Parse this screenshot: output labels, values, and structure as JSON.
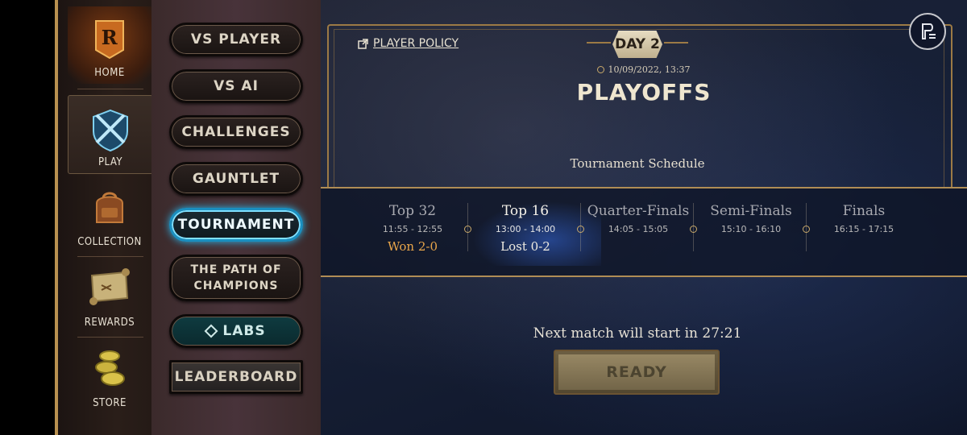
{
  "nav": {
    "items": [
      {
        "label": "HOME",
        "icon": "home-r-icon"
      },
      {
        "label": "PLAY",
        "icon": "crossed-swords-shield-icon"
      },
      {
        "label": "COLLECTION",
        "icon": "backpack-icon"
      },
      {
        "label": "REWARDS",
        "icon": "scroll-map-icon"
      },
      {
        "label": "STORE",
        "icon": "coins-icon"
      }
    ],
    "active": "PLAY"
  },
  "modes": {
    "vs_player": "VS PLAYER",
    "vs_ai": "VS AI",
    "challenges": "CHALLENGES",
    "gauntlet": "GAUNTLET",
    "tournament": "TOURNAMENT",
    "path_line1": "THE PATH OF",
    "path_line2": "CHAMPIONS",
    "labs": "LABS",
    "leaderboard": "LEADERBOARD",
    "active": "TOURNAMENT"
  },
  "main": {
    "player_policy": "PLAYER POLICY",
    "day": "DAY 2",
    "datetime": "10/09/2022, 13:37",
    "title": "PLAYOFFS",
    "schedule_title": "Tournament Schedule",
    "stages": [
      {
        "name": "Top 32",
        "time": "11:55 - 12:55",
        "result": "Won 2-0"
      },
      {
        "name": "Top 16",
        "time": "13:00 - 14:00",
        "result": "Lost 0-2"
      },
      {
        "name": "Quarter-Finals",
        "time": "14:05 - 15:05",
        "result": ""
      },
      {
        "name": "Semi-Finals",
        "time": "15:10 - 16:10",
        "result": ""
      },
      {
        "name": "Finals",
        "time": "16:15 - 17:15",
        "result": ""
      }
    ],
    "next_match": "Next match will start in 27:21",
    "ready": "READY"
  },
  "colors": {
    "gold": "#b08d55",
    "won": "#e8a54a",
    "lost": "#f0ece2",
    "active_glow": "#2bb6ea"
  }
}
